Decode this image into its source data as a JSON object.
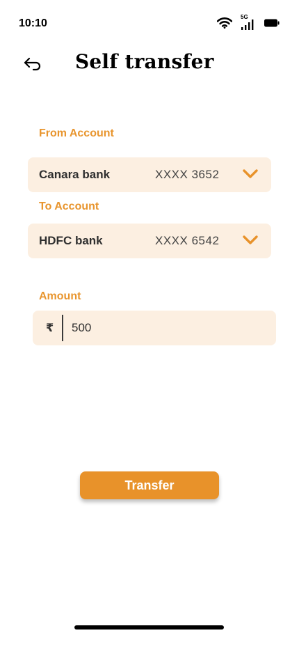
{
  "status_bar": {
    "time": "10:10",
    "network_label": "5G",
    "icons": [
      "wifi-icon",
      "cellular-signal-icon",
      "battery-icon"
    ]
  },
  "header": {
    "back_icon": "back-arrow-icon",
    "title": "Self transfer"
  },
  "form": {
    "from_account": {
      "label": "From Account",
      "bank": "Canara bank",
      "account_number": "XXXX 3652",
      "icon": "chevron-down-icon"
    },
    "to_account": {
      "label": "To Account",
      "bank": "HDFC bank",
      "account_number": "XXXX 6542",
      "icon": "chevron-down-icon"
    },
    "amount": {
      "label": "Amount",
      "currency_symbol": "₹",
      "value": "500"
    }
  },
  "actions": {
    "transfer_label": "Transfer"
  },
  "colors": {
    "accent": "#e8922a",
    "label": "#e8952e",
    "field_bg": "#fcefe1"
  }
}
